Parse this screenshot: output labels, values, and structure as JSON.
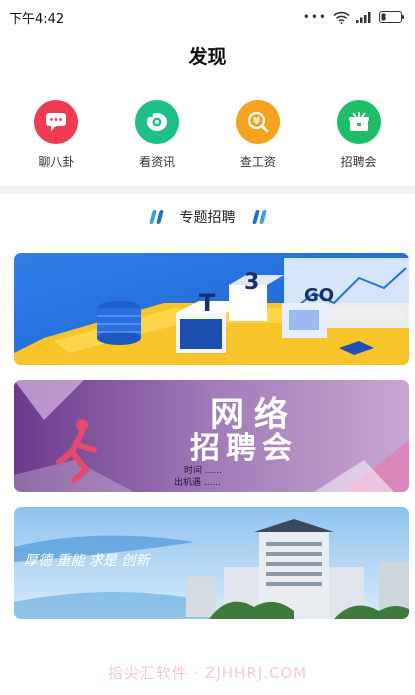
{
  "status": {
    "time": "下午4:42",
    "icons": [
      "more-dots-icon",
      "wifi-icon",
      "signal-icon",
      "battery-icon"
    ]
  },
  "header": {
    "title": "发现"
  },
  "quick_nav": [
    {
      "label": "聊八卦",
      "icon": "chat-icon",
      "color": "#ef3b52"
    },
    {
      "label": "看资讯",
      "icon": "news-icon",
      "color": "#1fbf8a"
    },
    {
      "label": "查工资",
      "icon": "salary-icon",
      "color": "#f5a21f"
    },
    {
      "label": "招聘会",
      "icon": "job-fair-icon",
      "color": "#1dbd69"
    }
  ],
  "section": {
    "title": "专题招聘"
  },
  "banners": [
    {
      "name": "banner-blue-isometric",
      "text": ""
    },
    {
      "name": "banner-online-job-fair",
      "title": "网络招聘会",
      "subtitle": "时间 ......",
      "line2": "出机遇 ......"
    },
    {
      "name": "banner-campus-building",
      "text": "厚德 重能 求是 创新"
    }
  ],
  "watermark": "指尖汇软件 · ZJHHRJ.COM"
}
